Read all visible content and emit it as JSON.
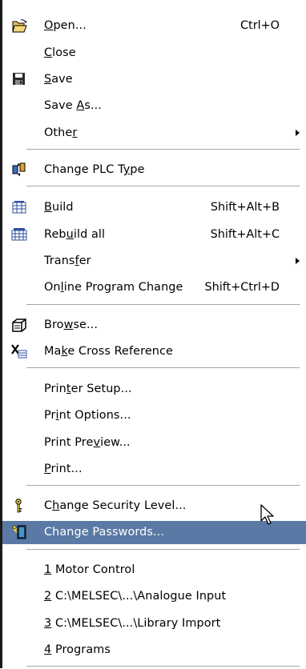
{
  "menu": {
    "items": [
      {
        "label": "Open...",
        "mnemonic": "O",
        "shortcut": "Ctrl+O",
        "icon": "open-folder-icon"
      },
      {
        "label": "Close",
        "mnemonic": "C"
      },
      {
        "label": "Save",
        "mnemonic": "S",
        "icon": "save-disk-icon"
      },
      {
        "label": "Save As...",
        "mnemonic": "A"
      },
      {
        "label": "Other",
        "mnemonic": "r",
        "submenu": true
      },
      {
        "label": "Change PLC Type",
        "mnemonic": "y",
        "icon": "change-plc-type-icon"
      },
      {
        "label": "Build",
        "mnemonic": "B",
        "shortcut": "Shift+Alt+B",
        "icon": "build-icon"
      },
      {
        "label": "Rebuild all",
        "mnemonic": "u",
        "shortcut": "Shift+Alt+C",
        "icon": "rebuild-all-icon"
      },
      {
        "label": "Transfer",
        "mnemonic": "f",
        "submenu": true
      },
      {
        "label": "Online Program Change",
        "mnemonic": "l",
        "shortcut": "Shift+Ctrl+D"
      },
      {
        "label": "Browse...",
        "mnemonic": "w",
        "icon": "browse-icon"
      },
      {
        "label": "Make Cross Reference",
        "mnemonic": "k",
        "icon": "cross-reference-icon"
      },
      {
        "label": "Printer Setup...",
        "mnemonic": "t"
      },
      {
        "label": "Print Options...",
        "mnemonic": "i"
      },
      {
        "label": "Print Preview...",
        "mnemonic": "v"
      },
      {
        "label": "Print...",
        "mnemonic": "P"
      },
      {
        "label": "Change Security Level...",
        "mnemonic": "h",
        "icon": "key-icon"
      },
      {
        "label": "Change Passwords...",
        "mnemonic": "",
        "icon": "change-passwords-icon",
        "highlighted": true
      },
      {
        "label": "1 Motor Control",
        "mnemonic": "1"
      },
      {
        "label": "2 C:\\MELSEC\\...\\Analogue Input",
        "mnemonic": "2"
      },
      {
        "label": "3 C:\\MELSEC\\...\\Library Import",
        "mnemonic": "3"
      },
      {
        "label": "4 Programs",
        "mnemonic": "4"
      }
    ]
  },
  "colors": {
    "highlight": "#5a79a5",
    "menu_background": "#ffffff",
    "separator": "#a5a5a5"
  }
}
